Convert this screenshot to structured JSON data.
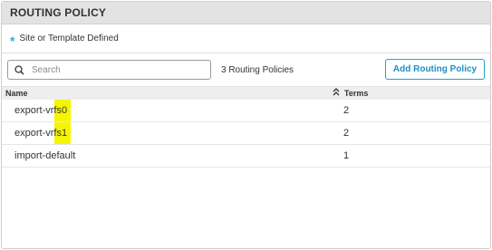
{
  "panel": {
    "title": "ROUTING POLICY"
  },
  "note": {
    "asterisk": "*",
    "text": "Site or Template Defined"
  },
  "toolbar": {
    "search_placeholder": "Search",
    "count_text": "3 Routing Policies",
    "add_button_label": "Add Routing Policy"
  },
  "table": {
    "headers": {
      "name": "Name",
      "terms": "Terms"
    },
    "rows": [
      {
        "name": "export-vrfs0",
        "terms": "2"
      },
      {
        "name": "export-vrfs1",
        "terms": "2"
      },
      {
        "name": "import-default",
        "terms": "1"
      }
    ]
  },
  "colors": {
    "accent": "#1fa3d6",
    "highlight": "#f5f500",
    "asterisk": "#4aa4d8"
  },
  "icons": {
    "search": "search-icon",
    "sort": "sort-icon"
  }
}
